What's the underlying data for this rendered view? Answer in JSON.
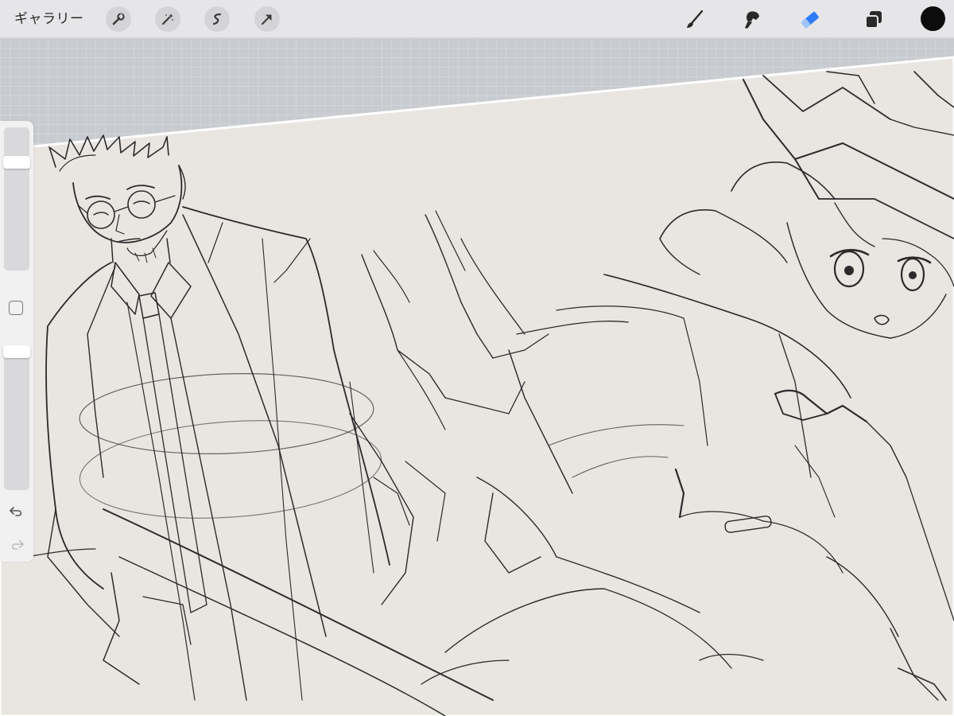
{
  "toolbar": {
    "gallery_label": "ギャラリー",
    "left_tools": [
      {
        "name": "wrench-icon"
      },
      {
        "name": "magic-wand-icon"
      },
      {
        "name": "selection-icon"
      },
      {
        "name": "transform-arrow-icon"
      }
    ],
    "right_tools": [
      {
        "name": "brush-icon"
      },
      {
        "name": "smudge-icon"
      },
      {
        "name": "eraser-icon",
        "active": true
      },
      {
        "name": "layers-icon"
      }
    ],
    "active_tool_color": "#2f7cf6",
    "current_color": "#0c0c0c"
  },
  "sidebar": {
    "brush_size_level": 0.78,
    "brush_opacity_level": 1.0,
    "icons": [
      "square-modify-icon",
      "undo-icon",
      "redo-icon"
    ]
  },
  "canvas": {
    "paper_color": "#e9e5e1",
    "stroke_color": "#2b2b2b",
    "workspace_color": "#c8cbcf"
  }
}
